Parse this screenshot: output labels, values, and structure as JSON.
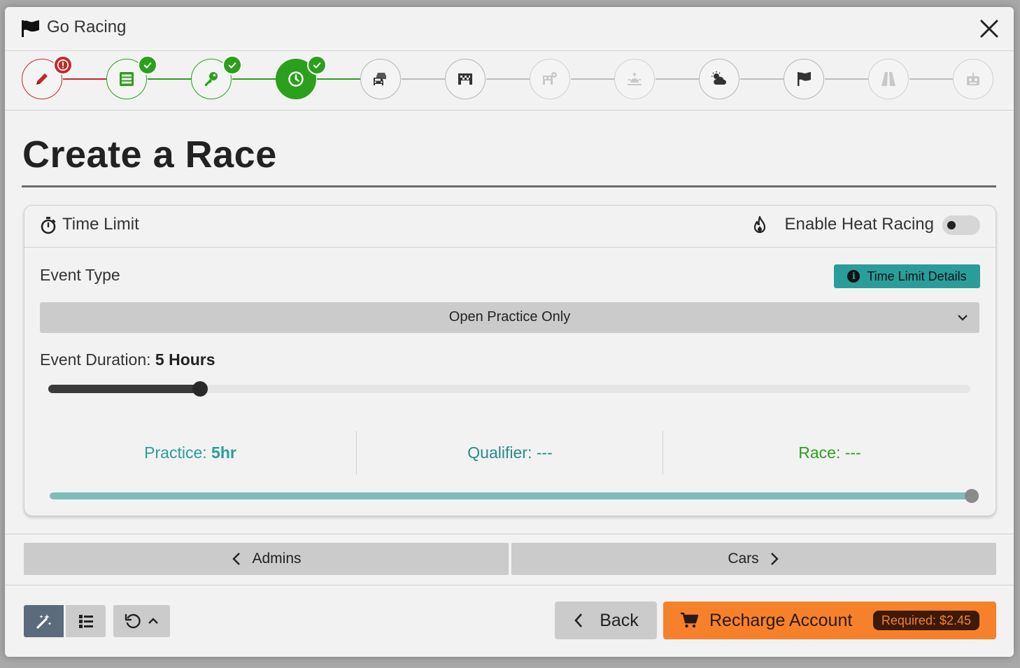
{
  "window": {
    "title": "Go Racing"
  },
  "steps": [
    {
      "name": "edit",
      "state": "error"
    },
    {
      "name": "server",
      "state": "done"
    },
    {
      "name": "key",
      "state": "done"
    },
    {
      "name": "clock",
      "state": "active"
    },
    {
      "name": "cars",
      "state": "pending"
    },
    {
      "name": "track",
      "state": "pending"
    },
    {
      "name": "track-settings",
      "state": "disabled"
    },
    {
      "name": "time-of-day",
      "state": "disabled"
    },
    {
      "name": "weather",
      "state": "pending"
    },
    {
      "name": "finish",
      "state": "pending"
    },
    {
      "name": "road",
      "state": "disabled"
    },
    {
      "name": "robot",
      "state": "disabled"
    }
  ],
  "page": {
    "heading": "Create a Race"
  },
  "card": {
    "title": "Time Limit",
    "heat_label": "Enable Heat Racing",
    "heat_enabled": false,
    "event_type_label": "Event Type",
    "details_button": "Time Limit Details",
    "event_type_value": "Open Practice Only",
    "duration_label": "Event Duration:",
    "duration_value": "5 Hours",
    "duration_fraction": 0.165,
    "phases": {
      "practice_label": "Practice:",
      "practice_value": "5hr",
      "qualifier": "Qualifier: ---",
      "race": "Race: ---"
    },
    "split_fraction": 1.0
  },
  "nav": {
    "prev": "Admins",
    "next": "Cars"
  },
  "footer": {
    "back": "Back",
    "recharge": "Recharge Account",
    "required": "Required: $2.45"
  },
  "colors": {
    "accent_green": "#2ba01c",
    "accent_teal": "#2a9d9b",
    "error_red": "#c62828",
    "recharge_orange": "#f7812a",
    "tool_active": "#5b6b7b"
  }
}
